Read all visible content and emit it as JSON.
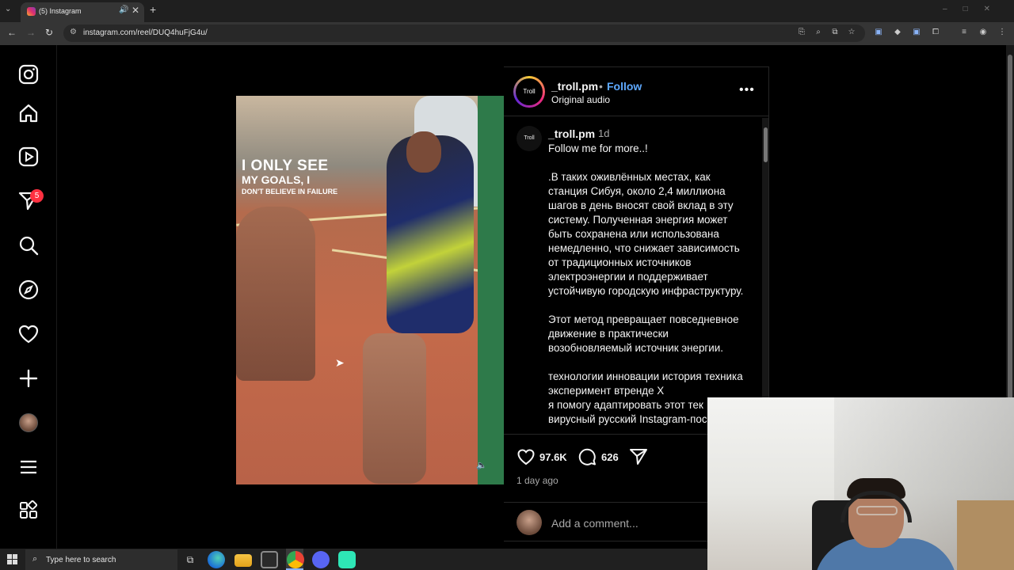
{
  "browser": {
    "tab_title": "(5) Instagram",
    "url": "instagram.com/reel/DUQ4huFjG4u/",
    "new_tab_symbol": "+",
    "tab_close_symbol": "✕"
  },
  "sidebar": {
    "notification_count": "5",
    "items": [
      "instagram-logo",
      "home",
      "reels",
      "messages",
      "search",
      "explore",
      "notifications",
      "create",
      "profile",
      "more",
      "also-from-meta"
    ]
  },
  "post": {
    "author": "_troll.pm",
    "follow_label": "Follow",
    "separator": "•",
    "audio": "Original audio",
    "avatar_text": "Troll",
    "more_symbol": "•••",
    "video_overlay": {
      "line1": "I ONLY SEE",
      "line2": "MY GOALS, I",
      "line3": "DON'T BELIEVE IN FAILURE"
    },
    "caption_author": "_troll.pm",
    "caption_time": "1d",
    "caption": "Follow me for more..!\n\n.В таких оживлённых местах, как станция Сибуя, около 2,4 миллиона шагов в день вносят свой вклад в эту систему. Полученная энергия может быть сохранена или использована немедленно, что снижает зависимость от традиционных источников электроэнергии и поддерживает устойчивую городскую инфраструктуру.\n\nЭтот метод превращает повседневное движение в практически возобновляемый источник энергии.\n\nтехнологии инновации история техника эксперимент втренде Х\nя помогу адаптировать этот тек\nвирусный русский Instagram-пос",
    "likes": "97.6K",
    "comments": "626",
    "posted": "1 day ago",
    "comment_placeholder": "Add a comment..."
  },
  "taskbar": {
    "search_placeholder": "Type here to search",
    "apps": [
      "task-view",
      "edge",
      "file-explorer",
      "store",
      "chrome",
      "discord",
      "app"
    ]
  },
  "colors": {
    "accent_follow": "#5ea9ff",
    "badge": "#ff3040",
    "background": "#000000"
  }
}
